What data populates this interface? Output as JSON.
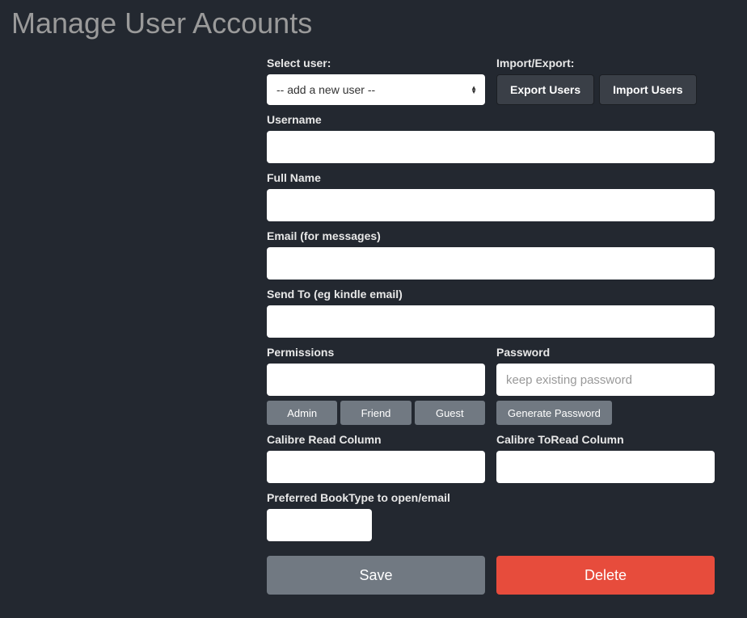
{
  "page": {
    "title": "Manage User Accounts"
  },
  "select_user": {
    "label": "Select user:",
    "selected": "-- add a new user --"
  },
  "import_export": {
    "label": "Import/Export:",
    "export_btn": "Export Users",
    "import_btn": "Import Users"
  },
  "fields": {
    "username": {
      "label": "Username",
      "value": ""
    },
    "fullname": {
      "label": "Full Name",
      "value": ""
    },
    "email": {
      "label": "Email (for messages)",
      "value": ""
    },
    "sendto": {
      "label": "Send To (eg kindle email)",
      "value": ""
    },
    "permissions": {
      "label": "Permissions",
      "value": "",
      "preset_admin": "Admin",
      "preset_friend": "Friend",
      "preset_guest": "Guest"
    },
    "password": {
      "label": "Password",
      "placeholder": "keep existing password",
      "value": "",
      "generate_btn": "Generate Password"
    },
    "calibre_read": {
      "label": "Calibre Read Column",
      "value": ""
    },
    "calibre_toread": {
      "label": "Calibre ToRead Column",
      "value": ""
    },
    "booktype": {
      "label": "Preferred BookType to open/email",
      "value": ""
    }
  },
  "actions": {
    "save": "Save",
    "delete": "Delete"
  }
}
